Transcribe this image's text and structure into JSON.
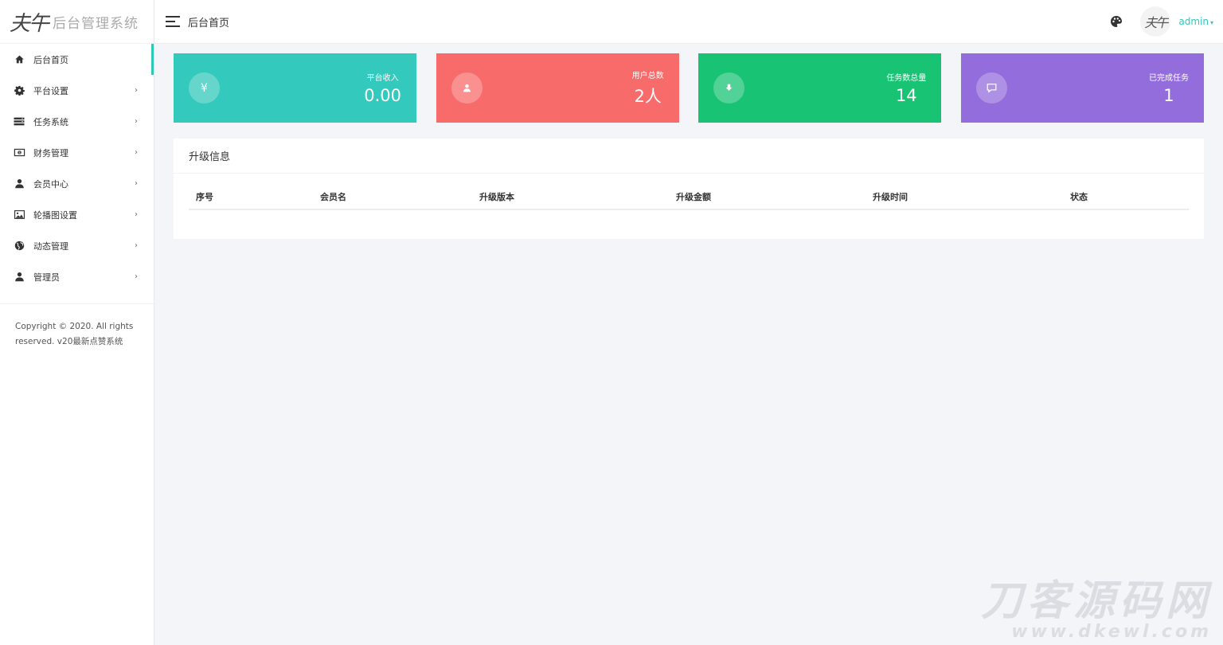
{
  "logo": {
    "mark": "夫午",
    "text": "后台管理系统"
  },
  "sidebar": {
    "items": [
      {
        "label": "后台首页",
        "icon": "home-icon",
        "active": true,
        "has_arrow": false
      },
      {
        "label": "平台设置",
        "icon": "gear-icon",
        "active": false,
        "has_arrow": true
      },
      {
        "label": "任务系统",
        "icon": "server-icon",
        "active": false,
        "has_arrow": true
      },
      {
        "label": "财务管理",
        "icon": "money-icon",
        "active": false,
        "has_arrow": true
      },
      {
        "label": "会员中心",
        "icon": "user-icon",
        "active": false,
        "has_arrow": true
      },
      {
        "label": "轮播图设置",
        "icon": "image-icon",
        "active": false,
        "has_arrow": true
      },
      {
        "label": "动态管理",
        "icon": "globe-icon",
        "active": false,
        "has_arrow": true
      },
      {
        "label": "管理员",
        "icon": "user-icon",
        "active": false,
        "has_arrow": true
      }
    ],
    "arrow": "›",
    "copyright": "Copyright © 2020. All rights reserved. v20最新点赞系统"
  },
  "header": {
    "breadcrumb": "后台首页",
    "avatar_text": "夫午",
    "user": "admin",
    "caret": "▾"
  },
  "cards": [
    {
      "title": "平台收入",
      "value": "0.00",
      "color": "#33c9bc",
      "icon": "yen-icon",
      "glyph": "¥"
    },
    {
      "title": "用户总数",
      "value": "2人",
      "color": "#f86b6b",
      "icon": "user-icon",
      "glyph": ""
    },
    {
      "title": "任务数总量",
      "value": "14",
      "color": "#18c374",
      "icon": "download-icon",
      "glyph": ""
    },
    {
      "title": "已完成任务",
      "value": "1",
      "color": "#936ddc",
      "icon": "comment-icon",
      "glyph": ""
    }
  ],
  "panel": {
    "title": "升级信息",
    "columns": [
      "序号",
      "会员名",
      "升级版本",
      "升级金额",
      "升级时间",
      "状态"
    ]
  },
  "watermark": {
    "line1": "刀客源码网",
    "line2": "www.dkewl.com"
  }
}
